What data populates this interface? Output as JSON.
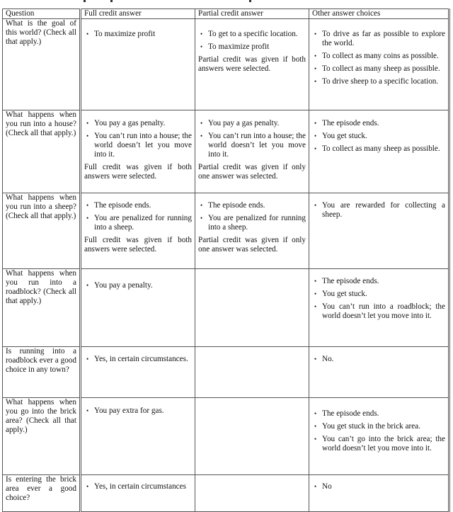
{
  "table": {
    "headers": {
      "question": "Question",
      "full": "Full credit answer",
      "partial": "Partial credit answer",
      "other": "Other answer choices"
    },
    "rows": [
      {
        "question": "What is the goal of this world? (Check all that apply.)",
        "full": [
          "To maximize profit"
        ],
        "full_note": "",
        "partial": [
          "To get to a specific location.",
          "To maximize profit"
        ],
        "partial_note": "Partial credit was given if both answers were selected.",
        "other": [
          "To drive as far as possible to explore the world.",
          "To collect as many coins as possible.",
          "To collect as many sheep as possible.",
          "To drive sheep to a specific location."
        ]
      },
      {
        "question": "What happens when you run into a house? (Check all that apply.)",
        "full": [
          "You pay a gas penalty.",
          "You can’t run into a house; the world doesn’t let you move into it."
        ],
        "full_note": "Full credit was given if both answers were selected.",
        "partial": [
          "You pay a gas penalty.",
          "You can’t run into a house; the world doesn’t let you move into it."
        ],
        "partial_note": "Partial credit was given if only one answer was selected.",
        "other": [
          "The episode ends.",
          "You get stuck.",
          "To collect as many sheep as possible."
        ]
      },
      {
        "question": "What happens when you run into a sheep? (Check all that apply.)",
        "full": [
          "The episode ends.",
          "You are penalized for running into a sheep."
        ],
        "full_note": "Full credit was given if both answers were selected.",
        "partial": [
          "The episode ends.",
          "You are penalized for running into a sheep."
        ],
        "partial_note": "Partial credit was given if only one answer was selected.",
        "other": [
          "You are rewarded for collecting a sheep."
        ]
      },
      {
        "question": "What happens when you run into a roadblock? (Check all that apply.)",
        "full": [
          "You pay a penalty."
        ],
        "full_note": "",
        "partial": [],
        "partial_note": "",
        "other": [
          "The episode ends.",
          "You get stuck.",
          "You can’t run into a roadblock; the world doesn’t let you move into it."
        ]
      },
      {
        "question": "Is running into a roadblock ever a good choice in any town?",
        "full": [
          "Yes, in certain circumstances."
        ],
        "full_note": "",
        "partial": [],
        "partial_note": "",
        "other": [
          "No."
        ]
      },
      {
        "question": "What happens when you go into the brick area? (Check all that apply.)",
        "full": [
          "You pay extra for gas."
        ],
        "full_note": "",
        "partial": [],
        "partial_note": "",
        "other": [
          "The episode ends.",
          "You get stuck in the brick area.",
          "You can’t go into the brick area; the world doesn’t let you move into it."
        ]
      },
      {
        "question": "Is entering the brick area ever a good choice?",
        "full": [
          "Yes, in certain circumstances"
        ],
        "full_note": "",
        "partial": [],
        "partial_note": "",
        "other": [
          "No"
        ]
      }
    ],
    "bullet_glyph": "•"
  }
}
